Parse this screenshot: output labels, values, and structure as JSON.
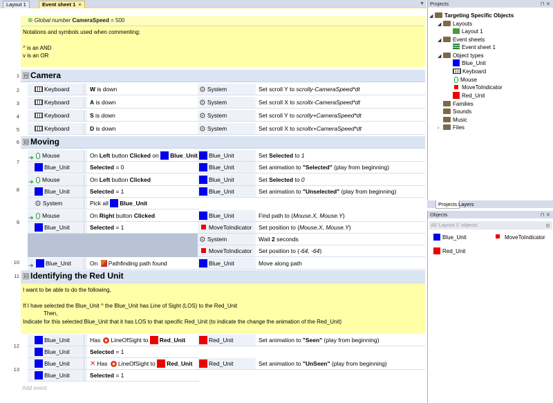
{
  "tabs": [
    {
      "label": "Layout 1"
    },
    {
      "label": "Event sheet 1",
      "close": "×"
    }
  ],
  "global_var": {
    "prefix": "Global number",
    "name": "CameraSpeed",
    "value": "= 500"
  },
  "header_comment": [
    "Notations and symbols used when commenting:",
    "",
    "^ is an AND",
    "v is an OR"
  ],
  "groups": {
    "camera": "Camera",
    "moving": "Moving",
    "identify": "Identifying the Red Unit"
  },
  "toggle": "⊟",
  "line_numbers": [
    "1",
    "2",
    "3",
    "4",
    "5",
    "6",
    "7",
    "8",
    "9",
    "10",
    "11",
    "12",
    "13"
  ],
  "camera_rows": [
    {
      "cond_obj": "Keyboard",
      "cond_key": "W",
      "cond_rest": "is down",
      "act_obj": "System",
      "act_pre": "Set scroll Y to ",
      "act_expr": "scrolly-CameraSpeed*dt"
    },
    {
      "cond_obj": "Keyboard",
      "cond_key": "A",
      "cond_rest": "is down",
      "act_obj": "System",
      "act_pre": "Set scroll X to ",
      "act_expr": "scrollx-CameraSpeed*dt"
    },
    {
      "cond_obj": "Keyboard",
      "cond_key": "S",
      "cond_rest": "is down",
      "act_obj": "System",
      "act_pre": "Set scroll Y to ",
      "act_expr": "scrolly+CameraSpeed*dt"
    },
    {
      "cond_obj": "Keyboard",
      "cond_key": "D",
      "cond_rest": "is down",
      "act_obj": "System",
      "act_pre": "Set scroll X to ",
      "act_expr": "scrollx+CameraSpeed*dt"
    }
  ],
  "moving": {
    "e7": {
      "c1_obj": "Mouse",
      "c1_pre": "On ",
      "c1_btn": "Left",
      "c1_mid": " button ",
      "c1_clk": "Clicked",
      "c1_on": " on ",
      "c1_tgt": "Blue_Unit",
      "c2_obj": "Blue_Unit",
      "c2_key": "Selected",
      "c2_rest": " = 0",
      "a1_obj": "Blue_Unit",
      "a1_pre": "Set ",
      "a1_key": "Selected",
      "a1_mid": " to ",
      "a1_val": "1",
      "a2_obj": "Blue_Unit",
      "a2_pre": "Set animation to ",
      "a2_val": "\"Selected\"",
      "a2_post": " (play from beginning)"
    },
    "e8": {
      "c1_obj": "Mouse",
      "c1_pre": "On ",
      "c1_btn": "Left",
      "c1_mid": " button ",
      "c1_clk": "Clicked",
      "c2_obj": "Blue_Unit",
      "c2_key": "Selected",
      "c2_rest": " = 1",
      "c3_obj": "System",
      "c3_pre": "Pick all ",
      "c3_tgt": "Blue_Unit",
      "a1_obj": "Blue_Unit",
      "a1_pre": "Set ",
      "a1_key": "Selected",
      "a1_mid": " to ",
      "a1_val": "0",
      "a2_obj": "Blue_Unit",
      "a2_pre": "Set animation to ",
      "a2_val": "\"Unselected\"",
      "a2_post": " (play from beginning)"
    },
    "e9": {
      "c1_obj": "Mouse",
      "c1_pre": "On ",
      "c1_btn": "Right",
      "c1_mid": " button ",
      "c1_clk": "Clicked",
      "c2_obj": "Blue_Unit",
      "c2_key": "Selected",
      "c2_rest": " = 1",
      "a1_obj": "Blue_Unit",
      "a1_pre": "Find path to (",
      "a1_expr": "Mouse.X, Mouse.Y",
      "a1_post": ")",
      "a2_obj": "MoveToIndicator",
      "a2_pre": "Set position to (",
      "a2_expr": "Mouse.X, Mouse.Y",
      "a2_post": ")",
      "a3_obj": "System",
      "a3_pre": "Wait ",
      "a3_val": "2",
      "a3_post": " seconds",
      "a4_obj": "MoveToIndicator",
      "a4_pre": "Set position to (",
      "a4_expr": "-64, -64",
      "a4_post": ")"
    },
    "e10": {
      "c1_obj": "Blue_Unit",
      "c1_pre": "On ",
      "c1_rest": "Pathfinding path found",
      "a1_obj": "Blue_Unit",
      "a1_text": "Move along path"
    }
  },
  "identify_comment": [
    "I want to be able to do the following,",
    "",
    "If I have selected the Blue_Unit ^ the Blue_Unit has Line of Sight (LOS) to the Red_Unit",
    "Then,",
    "Indicate for this selected Blue_Unit that it has LOS to that specific Red_Unit (to indicate the change the animation of the Red_Unit)"
  ],
  "e12": {
    "c1_obj": "Blue_Unit",
    "c1_pre": "Has ",
    "c1_mid": "LineOfSight to ",
    "c1_tgt": "Red_Unit",
    "c2_obj": "Blue_Unit",
    "c2_key": "Selected",
    "c2_rest": " = 1",
    "a1_obj": "Red_Unit",
    "a1_pre": "Set animation to ",
    "a1_val": "\"Seen\"",
    "a1_post": " (play from beginning)"
  },
  "e13": {
    "c1_obj": "Blue_Unit",
    "c1_pre": "Has ",
    "c1_mid": "LineOfSight to ",
    "c1_tgt": "Red_Unit",
    "c2_obj": "Blue_Unit",
    "c2_key": "Selected",
    "c2_rest": " = 1",
    "a1_obj": "Red_Unit",
    "a1_pre": "Set animation to ",
    "a1_val": "\"UnSeen\"",
    "a1_post": " (play from beginning)"
  },
  "add_event": "Add event",
  "projects_panel": {
    "title": "Projects",
    "pin": "⊓ ✕",
    "root": "Targeting Specific Objects",
    "items": {
      "layouts": "Layouts",
      "layout1": "Layout 1",
      "eventsheets": "Event sheets",
      "eventsheet1": "Event sheet 1",
      "objtypes": "Object types",
      "blue": "Blue_Unit",
      "keyboard": "Keyboard",
      "mouse": "Mouse",
      "movetoind": "MoveToIndicator",
      "red": "Red_Unit",
      "families": "Families",
      "sounds": "Sounds",
      "music": "Music",
      "files": "Files"
    }
  },
  "panel_tabs": [
    "Projects",
    "Layers"
  ],
  "objects_panel": {
    "title": "Objects",
    "pin": "⊓ ✕",
    "filter": "All 'Layout 1' objects",
    "items": [
      "Blue_Unit",
      "MoveToIndicator",
      "Red_Unit"
    ]
  },
  "colors": {
    "blue": "#0000ee",
    "red": "#ee0000",
    "comment": "#ffffa8",
    "group": "#dbe4f2"
  }
}
